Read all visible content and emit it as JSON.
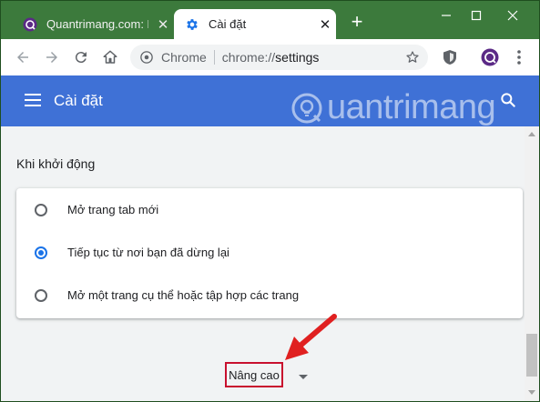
{
  "tabs": [
    {
      "title": "Quantrimang.com: Ki",
      "icon": "quantrimang-favicon-icon",
      "active": false
    },
    {
      "title": "Cài đặt",
      "icon": "settings-gear-icon",
      "active": true
    }
  ],
  "new_tab_label": "+",
  "omnibox": {
    "chip": "Chrome",
    "url_scheme": "chrome://",
    "url_path": "settings"
  },
  "header": {
    "title": "Cài đặt"
  },
  "watermark": {
    "text": "uantrimang"
  },
  "startup": {
    "section_title": "Khi khởi động",
    "options": [
      {
        "label": "Mở trang tab mới",
        "checked": false
      },
      {
        "label": "Tiếp tục từ nơi bạn đã dừng lại",
        "checked": true
      },
      {
        "label": "Mở một trang cụ thể hoặc tập hợp các trang",
        "checked": false
      }
    ]
  },
  "advanced": {
    "label": "Nâng cao"
  },
  "colors": {
    "tabstrip": "#3c7a3c",
    "appbar": "#3f71d6",
    "accent": "#1a73e8",
    "highlight": "#c8102e",
    "arrow": "#e02020"
  }
}
